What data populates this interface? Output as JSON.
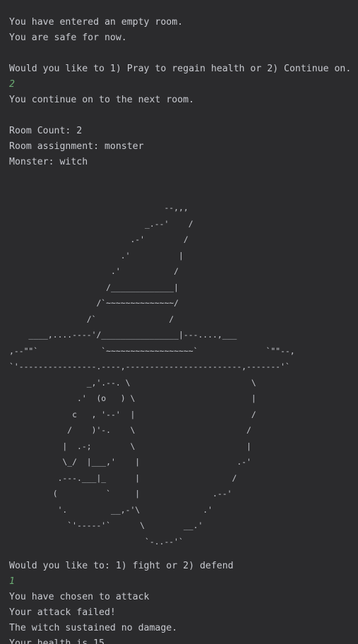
{
  "console": {
    "lines": [
      {
        "text": "You have entered an empty room.",
        "kind": "output"
      },
      {
        "text": "You are safe for now.",
        "kind": "output"
      },
      {
        "text": "",
        "kind": "blank"
      },
      {
        "text": "Would you like to 1) Pray to regain health or 2) Continue on.",
        "kind": "output"
      },
      {
        "text": "2",
        "kind": "input"
      },
      {
        "text": "You continue on to the next room.",
        "kind": "output"
      },
      {
        "text": "",
        "kind": "blank"
      },
      {
        "text": "Room Count: 2",
        "kind": "output"
      },
      {
        "text": "Room assignment: monster",
        "kind": "output"
      },
      {
        "text": "Monster: witch",
        "kind": "output"
      }
    ],
    "ascii_art": "                                --,,,\n                            _.--'    /\n                         .-'        /\n                       .'          |\n                     .'           /\n                    /_____________|\n                  /`~~~~~~~~~~~~~~/\n                /`               /\n    ____,....----'/________________|---....,___\n,--\"\"`             `~~~~~~~~~~~~~~~~~~`              `\"\"--,\n`'----------------.----,------------------------,-------'`\n                _,'.--. \\                         \\\n              .'  (o   ) \\                        |\n             c   , '--'  |                        /\n            /    )'-.    \\                       /\n           |  .-;        \\                       |\n           \\_/  |___,'    |                    .-'\n          .---.___|_      |                   /\n         (          `     |               .--'\n          '.         __,-'\\             .'\n            `'-----'`      \\        __.'\n                            `-..--'`",
    "after_lines": [
      {
        "text": "Would you like to: 1) fight or 2) defend",
        "kind": "output"
      },
      {
        "text": "1",
        "kind": "input"
      },
      {
        "text": "You have chosen to attack",
        "kind": "output"
      },
      {
        "text": "Your attack failed!",
        "kind": "output"
      },
      {
        "text": "The witch sustained no damage.",
        "kind": "output"
      },
      {
        "text": "Your health is 15",
        "kind": "output"
      }
    ]
  },
  "colors": {
    "background": "#2b2b2d",
    "text": "#c8cad0",
    "user_input": "#6aab73"
  }
}
